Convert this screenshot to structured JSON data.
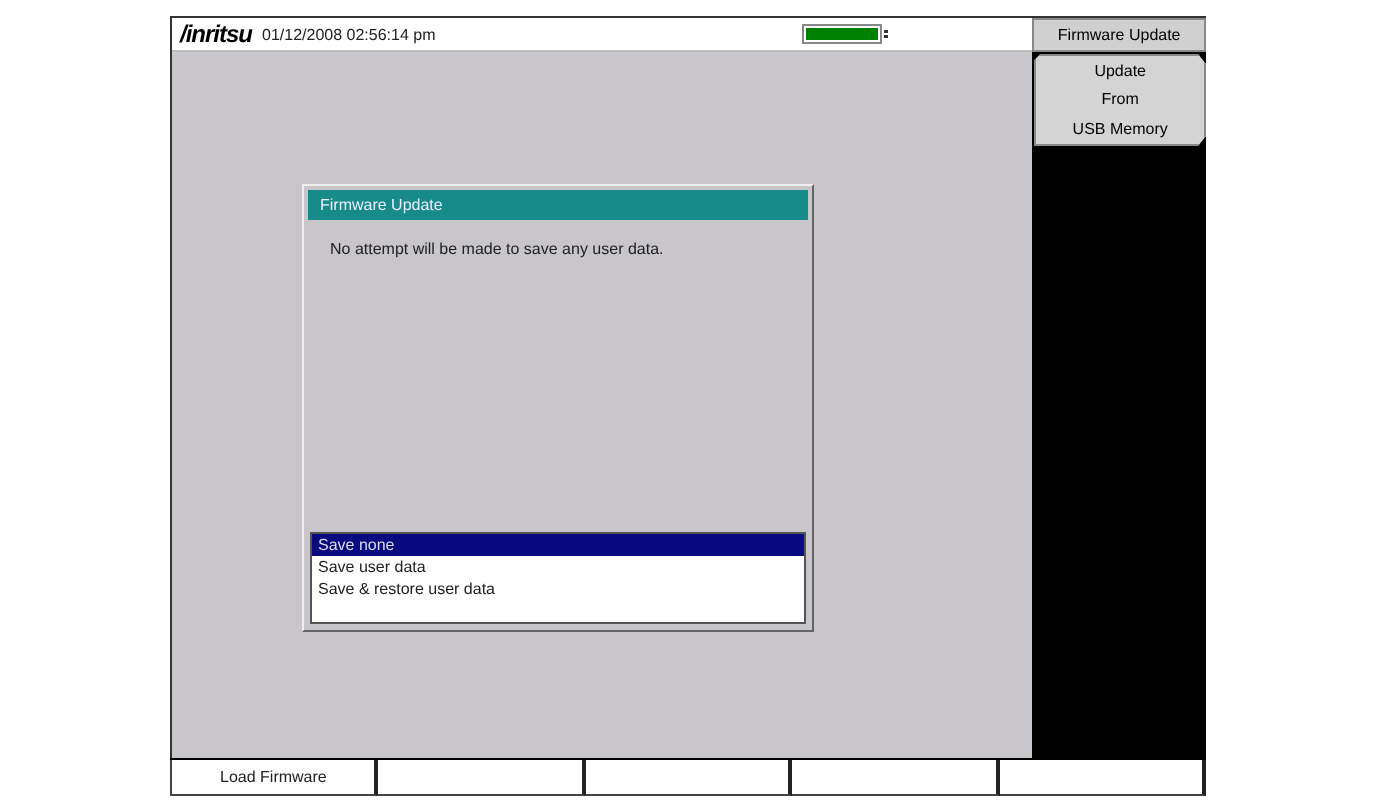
{
  "header": {
    "logo": "/inritsu",
    "datetime": "01/12/2008 02:56:14 pm"
  },
  "dialog": {
    "title": "Firmware Update",
    "message": "No attempt will be made to save any user data.",
    "options": [
      {
        "label": "Save none",
        "selected": true
      },
      {
        "label": "Save user data",
        "selected": false
      },
      {
        "label": "Save & restore user data",
        "selected": false
      }
    ]
  },
  "menu": {
    "title": "Firmware Update",
    "buttons": [
      {
        "lines": [
          "Update",
          "From",
          "USB Memory"
        ]
      }
    ]
  },
  "soft_keys": [
    {
      "kind": "labeled",
      "label": "Load Firmware"
    },
    {
      "kind": "blank"
    },
    {
      "kind": "blank"
    },
    {
      "kind": "blank"
    },
    {
      "kind": "blank"
    }
  ]
}
